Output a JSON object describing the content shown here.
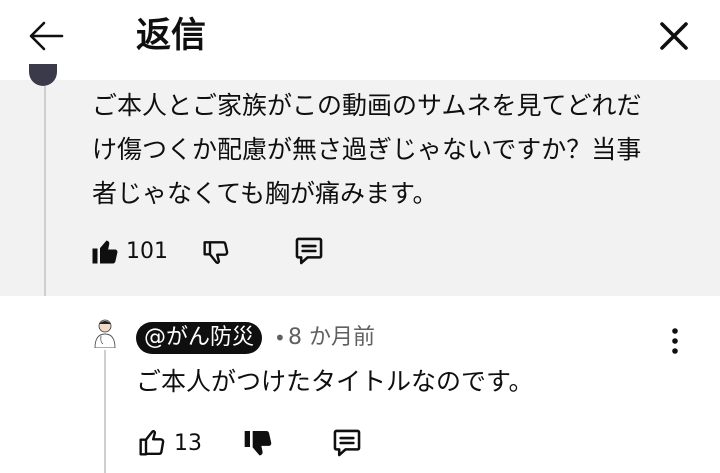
{
  "header": {
    "title": "返信"
  },
  "parent_comment": {
    "text_lines": [
      "ご本人とご家族がこの動画のサムネを見てどれだ",
      "け傷つくか配慮が無さ過ぎじゃないですか？当事",
      "者じゃなくても胸が痛みます。"
    ],
    "like_count": "101",
    "liked": true
  },
  "reply_comment": {
    "handle": "@がん防災",
    "separator": "•",
    "time": "8 か月前",
    "text": "ご本人がつけたタイトルなのです。",
    "like_count": "13",
    "disliked": true
  },
  "colors": {
    "parent_bg": "#f2f2f2",
    "handle_bg": "#0f0f0f",
    "secondary_text": "#606060"
  },
  "icons": [
    "back-arrow-icon",
    "close-icon",
    "thumbs-up-icon",
    "thumbs-down-icon",
    "reply-comment-icon",
    "more-options-icon"
  ]
}
